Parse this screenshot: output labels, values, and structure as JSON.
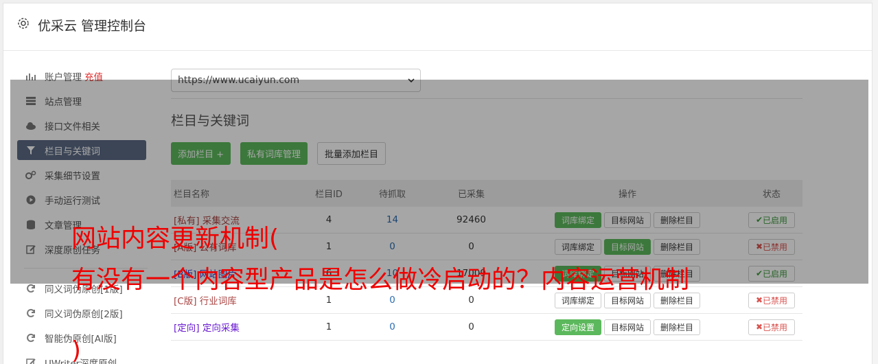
{
  "app": {
    "title": "优采云 管理控制台"
  },
  "sidebar": {
    "items": [
      {
        "label": "账户管理",
        "extra": "充值",
        "icon": "bar-chart-icon"
      },
      {
        "label": "站点管理",
        "icon": "server-icon"
      },
      {
        "label": "接口文件相关",
        "icon": "cloud-upload-icon"
      },
      {
        "label": "栏目与关键词",
        "icon": "filter-icon",
        "active": true
      },
      {
        "label": "采集细节设置",
        "icon": "cogs-icon"
      },
      {
        "label": "手动运行测试",
        "icon": "play-circle-icon"
      },
      {
        "label": "文章管理",
        "icon": "database-icon"
      },
      {
        "label": "深度原创任务",
        "icon": "edit-icon"
      }
    ],
    "items2": [
      {
        "label": "同义词伪原创[1版]",
        "icon": "refresh-icon"
      },
      {
        "label": "同义词伪原创[2版]",
        "icon": "refresh-icon"
      },
      {
        "label": "智能伪原创[AI版]",
        "icon": "refresh-icon"
      },
      {
        "label": "UWriter深度原创",
        "icon": "edit-icon"
      }
    ]
  },
  "site_select": {
    "value": "https://www.ucaiyun.com"
  },
  "section": {
    "title": "栏目与关键词",
    "buttons": {
      "add": "添加栏目 +",
      "private": "私有词库管理",
      "batch": "批量添加栏目"
    }
  },
  "table": {
    "headers": {
      "name": "栏目名称",
      "id": "栏目ID",
      "queue": "待抓取",
      "got": "已采集",
      "ops": "操作",
      "status": "状态"
    },
    "rows": [
      {
        "tag": "[私有]",
        "name": "采集交流",
        "id": "4",
        "queue": "14",
        "got": "92460",
        "op1": "词库绑定",
        "op2": "目标网站",
        "op3": "删除栏目",
        "status": "已启用",
        "enabled": true
      },
      {
        "tag": "[A版]",
        "name": "公有词库",
        "id": "1",
        "queue": "0",
        "got": "0",
        "op1": "词库绑定",
        "op2": "目标网站",
        "op3": "删除栏目",
        "status": "已禁用",
        "enabled": false
      },
      {
        "tag": "[B版]",
        "name": "网站图片",
        "id": "6",
        "queue": "10",
        "got": "17009",
        "op1": "词库绑定",
        "op2": "目标网站",
        "op3": "删除栏目",
        "status": "已启用",
        "enabled": true
      },
      {
        "tag": "[C版]",
        "name": "行业词库",
        "id": "1",
        "queue": "0",
        "got": "0",
        "op1": "词库绑定",
        "op2": "目标网站",
        "op3": "删除栏目",
        "status": "已禁用",
        "enabled": false
      },
      {
        "tag": "[定向]",
        "name": "定向采集",
        "id": "1",
        "queue": "0",
        "got": "0",
        "op1": "定向设置",
        "op2": "目标网站",
        "op3": "删除栏目",
        "status": "已禁用",
        "enabled": false
      }
    ]
  },
  "overlay": {
    "line1": "网站内容更新机制(",
    "line2": "有没有一个内容型产品是怎么做冷启动的？内容运营机制",
    "line3": ")"
  },
  "colors": {
    "accent": "#5cb85c",
    "danger": "#d9534f",
    "active_nav": "#5b6b85",
    "overlay_text": "#e00000"
  }
}
